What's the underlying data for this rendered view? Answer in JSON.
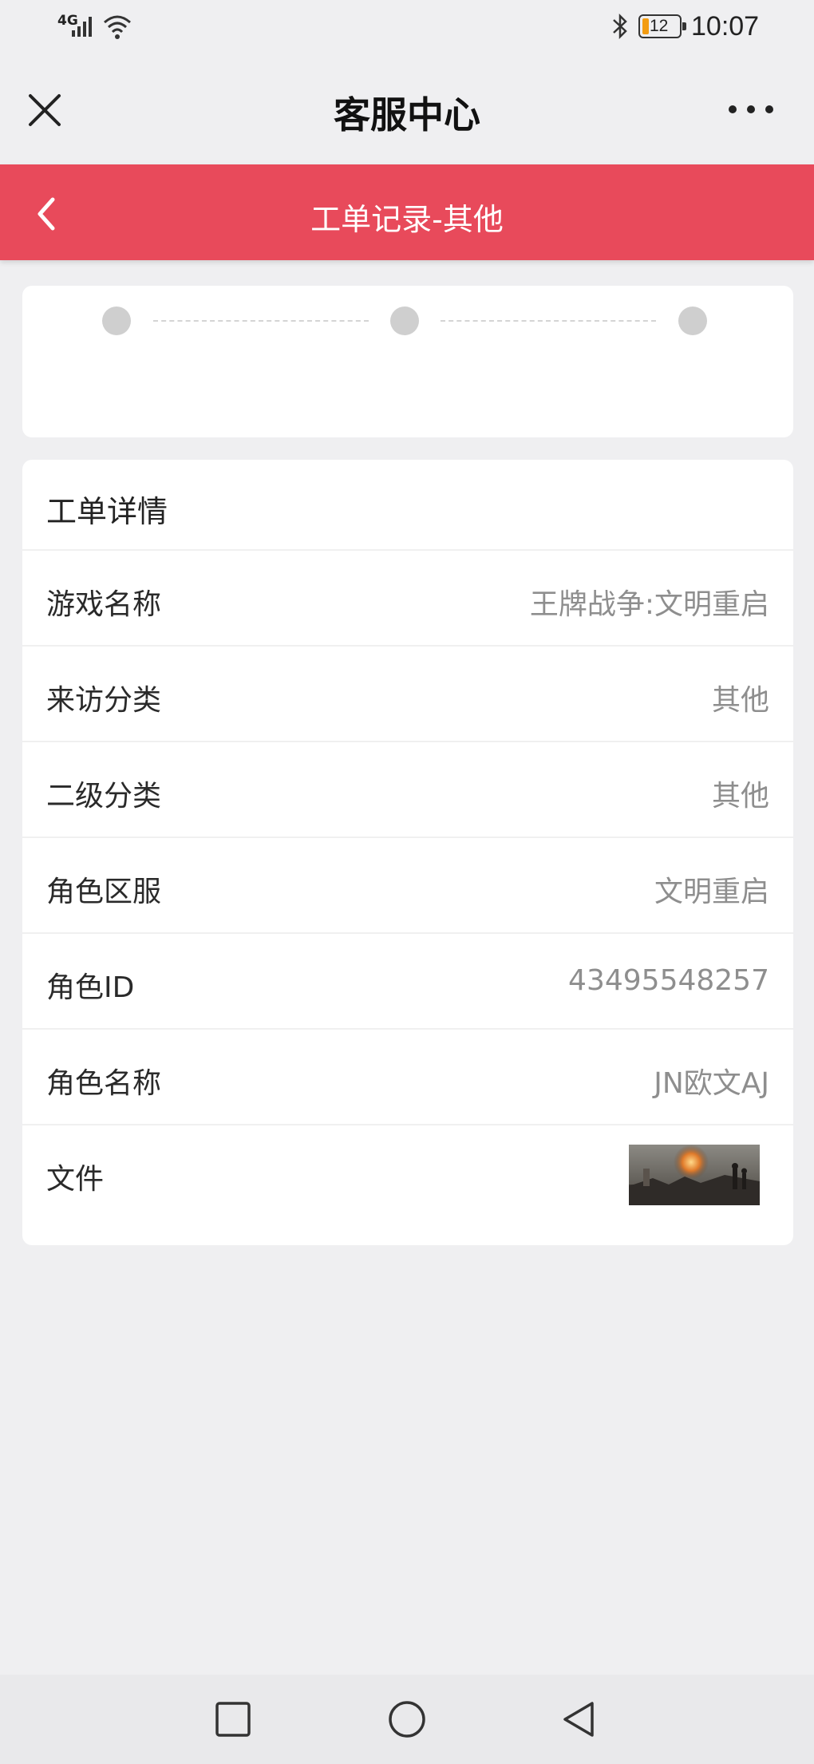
{
  "status_bar": {
    "network": "4G",
    "battery_level": "12",
    "time": "10:07"
  },
  "titlebar": {
    "title": "客服中心",
    "close_icon": "close-icon",
    "more_icon": "more-dots-icon"
  },
  "header": {
    "title": "工单记录-其他",
    "back_icon": "back-chevron-icon",
    "background_color": "#e84a5b"
  },
  "progress": {
    "step_count": 3,
    "dot_color": "#cfcfcf"
  },
  "detail": {
    "title": "工单详情",
    "rows": [
      {
        "label": "游戏名称",
        "value": "王牌战争:文明重启"
      },
      {
        "label": "来访分类",
        "value": "其他"
      },
      {
        "label": "二级分类",
        "value": "其他"
      },
      {
        "label": "角色区服",
        "value": "文明重启"
      },
      {
        "label": "角色ID",
        "value": "43495548257"
      },
      {
        "label": "角色名称",
        "value": "JN欧文AJ"
      }
    ],
    "file_label": "文件",
    "file_thumbnail": "game-screenshot-thumbnail"
  },
  "nav_bar": {
    "recent_icon": "square-recent-apps-icon",
    "home_icon": "circle-home-icon",
    "back_icon": "triangle-back-icon"
  }
}
